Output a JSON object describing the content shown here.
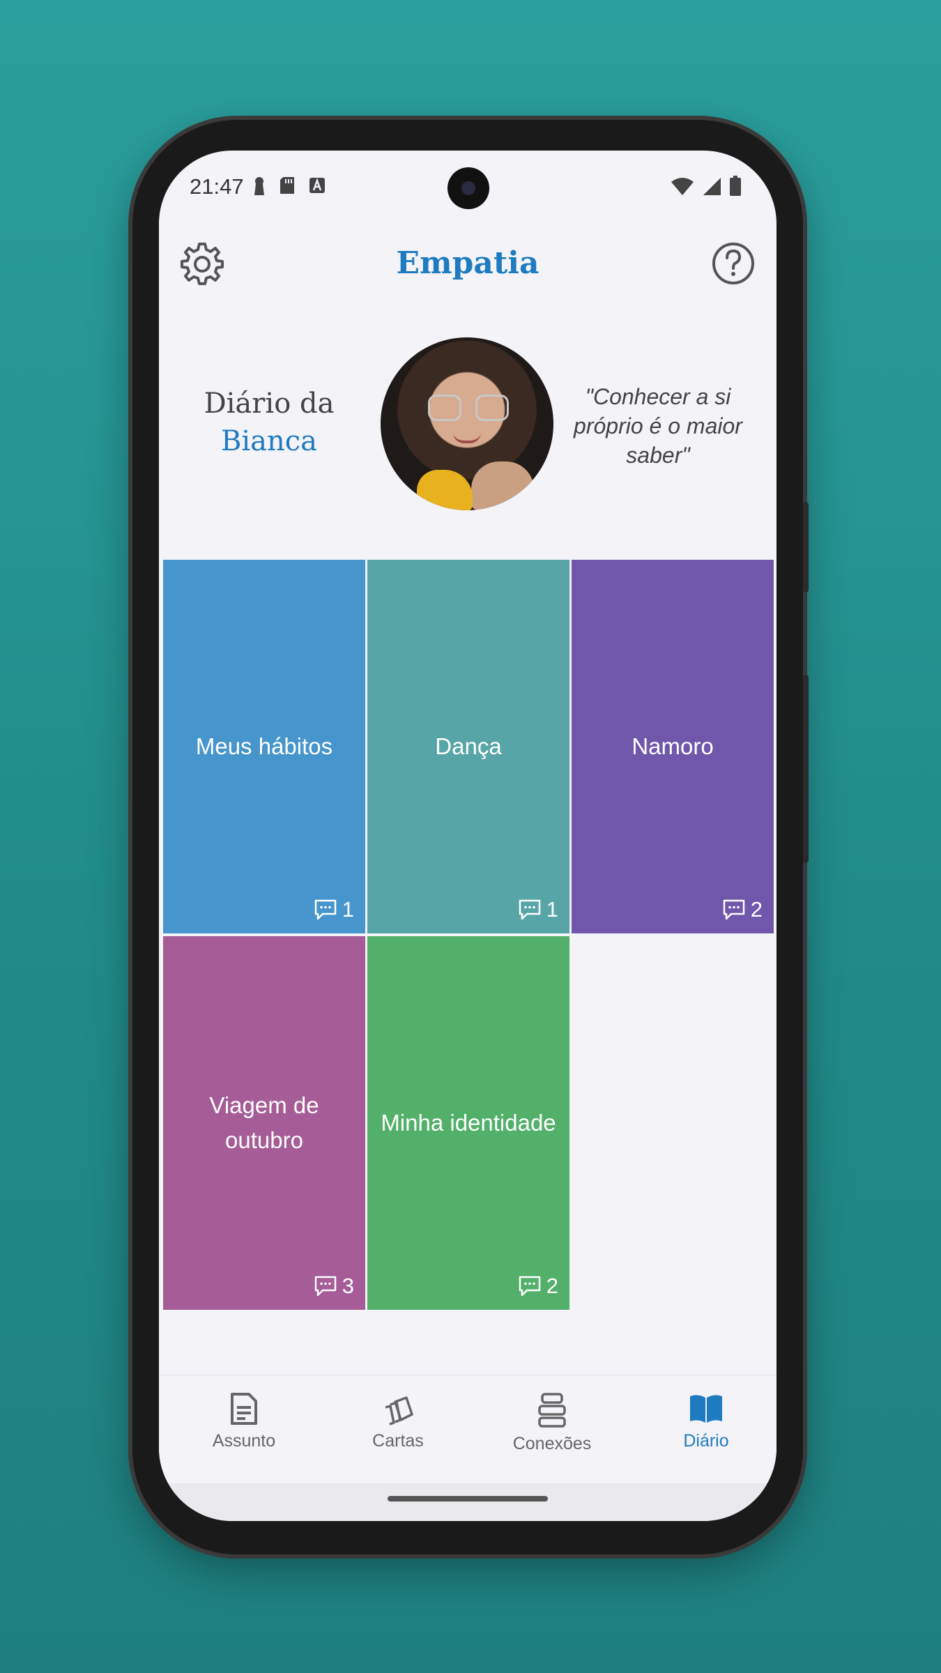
{
  "status_bar": {
    "time": "21:47"
  },
  "header": {
    "title": "Empatia",
    "settings_icon": "gear-icon",
    "help_icon": "help-circle-icon"
  },
  "profile": {
    "diary_prefix": "Diário da",
    "diary_name": "Bianca",
    "quote": "\"Conhecer a si próprio é o maior saber\""
  },
  "topics": [
    {
      "label": "Meus hábitos",
      "count": "1",
      "color": "#4795cd"
    },
    {
      "label": "Dança",
      "count": "1",
      "color": "#58a5a7"
    },
    {
      "label": "Namoro",
      "count": "2",
      "color": "#7157ac"
    },
    {
      "label": "Viagem de outubro",
      "count": "3",
      "color": "#a55c97"
    },
    {
      "label": "Minha identidade",
      "count": "2",
      "color": "#52b06a"
    }
  ],
  "bottom_nav": {
    "items": [
      {
        "label": "Assunto",
        "icon": "document-icon"
      },
      {
        "label": "Cartas",
        "icon": "cards-icon"
      },
      {
        "label": "Conexões",
        "icon": "stack-icon"
      },
      {
        "label": "Diário",
        "icon": "book-icon"
      }
    ],
    "active": "Diário",
    "active_color": "#1f7bc0"
  }
}
